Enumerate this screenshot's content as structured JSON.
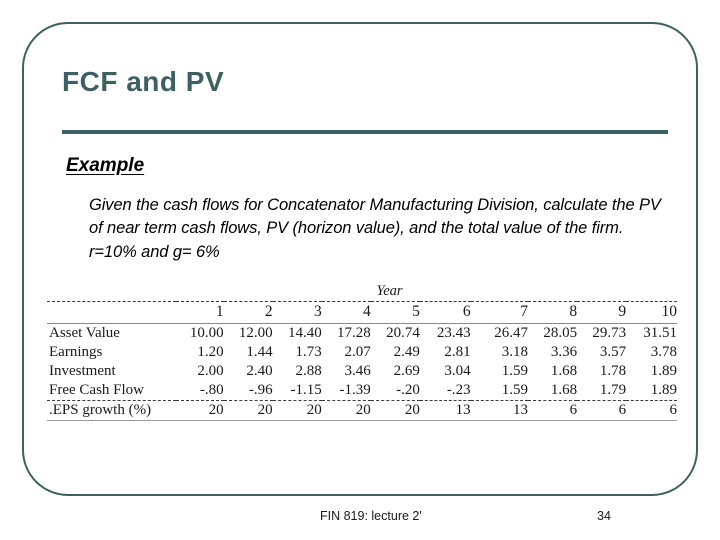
{
  "slide": {
    "title": "FCF and PV",
    "example_heading": "Example",
    "example_body": "Given the cash flows for Concatenator Manufacturing Division, calculate the PV of near term cash flows, PV (horizon value), and the total value of the firm. r=10% and g= 6%",
    "accent_color": "#3d6063",
    "frame_color": "#3d6063"
  },
  "table": {
    "caption": "Year",
    "columns": [
      "1",
      "2",
      "3",
      "4",
      "5",
      "6",
      "7",
      "8",
      "9",
      "10"
    ],
    "rows": [
      {
        "label": "Asset Value",
        "values": [
          "10.00",
          "12.00",
          "14.40",
          "17.28",
          "20.74",
          "23.43",
          "26.47",
          "28.05",
          "29.73",
          "31.51"
        ]
      },
      {
        "label": "Earnings",
        "values": [
          "1.20",
          "1.44",
          "1.73",
          "2.07",
          "2.49",
          "2.81",
          "3.18",
          "3.36",
          "3.57",
          "3.78"
        ]
      },
      {
        "label": "Investment",
        "values": [
          "2.00",
          "2.40",
          "2.88",
          "3.46",
          "2.69",
          "3.04",
          "1.59",
          "1.68",
          "1.78",
          "1.89"
        ]
      },
      {
        "label": "Free Cash Flow",
        "values": [
          "-.80",
          "-.96",
          "-1.15",
          "-1.39",
          "-.20",
          "-.23",
          "1.59",
          "1.68",
          "1.79",
          "1.89"
        ]
      },
      {
        "label": ".EPS growth  (%)",
        "values": [
          "20",
          "20",
          "20",
          "20",
          "20",
          "13",
          "13",
          "6",
          "6",
          "6"
        ]
      }
    ]
  },
  "footer": {
    "text": "FIN 819: lecture 2'",
    "page": "34"
  }
}
